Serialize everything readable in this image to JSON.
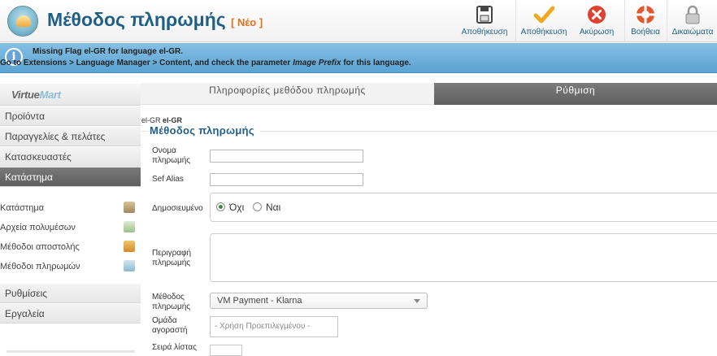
{
  "header": {
    "title": "Μέθοδος πληρωμής",
    "tag": "[ Νέο ]",
    "toolbar": [
      {
        "label": "Αποθήκευση",
        "icon": "save-icon"
      },
      {
        "label": "Αποθήκευση",
        "icon": "checkmark-icon"
      },
      {
        "label": "Ακύρωση",
        "icon": "cancel-icon"
      },
      {
        "label": "Βοήθεια",
        "icon": "lifebuoy-help-icon"
      },
      {
        "label": "Δικαιώματα",
        "icon": "lock-icon"
      }
    ]
  },
  "notice": {
    "line1": "Missing Flag el-GR for language el-GR.",
    "line2_prefix": "Go to Extensions > Language Manager > Content, and check the parameter ",
    "line2_em": "Image Prefix",
    "line2_suffix": " for this language."
  },
  "sidebar": {
    "logo_a": "Virtue",
    "logo_b": "Mart",
    "menu": [
      {
        "label": "Προϊόντα"
      },
      {
        "label": "Παραγγελίες & πελάτες"
      },
      {
        "label": "Κατασκευαστές"
      },
      {
        "label": "Κατάστημα",
        "active": true
      }
    ],
    "submenu": [
      {
        "label": "Κατάστημα",
        "icon": "shop-icon"
      },
      {
        "label": "Αρχεία πολυμέσων",
        "icon": "media-icon"
      },
      {
        "label": "Μέθοδοι αποστολής",
        "icon": "truck-icon"
      },
      {
        "label": "Μέθοδοι πληρωμών",
        "icon": "payment-icon"
      }
    ],
    "menu_bottom": [
      {
        "label": "Ρυθμίσεις"
      },
      {
        "label": "Εργαλεία"
      }
    ]
  },
  "tabs": [
    {
      "label": "Πληροφορίες μεθόδου πληρωμής",
      "active": true
    },
    {
      "label": "Ρύθμιση",
      "active": false
    }
  ],
  "form": {
    "flag_prefix": "el-GR",
    "flag_bold": "el-GR",
    "legend": "Μέθοδος πληρωμής",
    "name_label": "Ονομα πληρωμής",
    "name_value": "",
    "sef_label": "Sef Alias",
    "sef_value": "",
    "published_label": "Δημοσιευμένο",
    "published_no": "Όχι",
    "published_yes": "Ναι",
    "description_label": "Περιγραφή πληρωμής",
    "method_label": "Μέθοδος πληρωμής",
    "method_value": "VM Payment - Klarna",
    "group_label": "Ομάδα αγοραστή",
    "group_placeholder": "- Χρήση Προεπιλεγμένου -",
    "order_label": "Σειρά λίστας"
  }
}
